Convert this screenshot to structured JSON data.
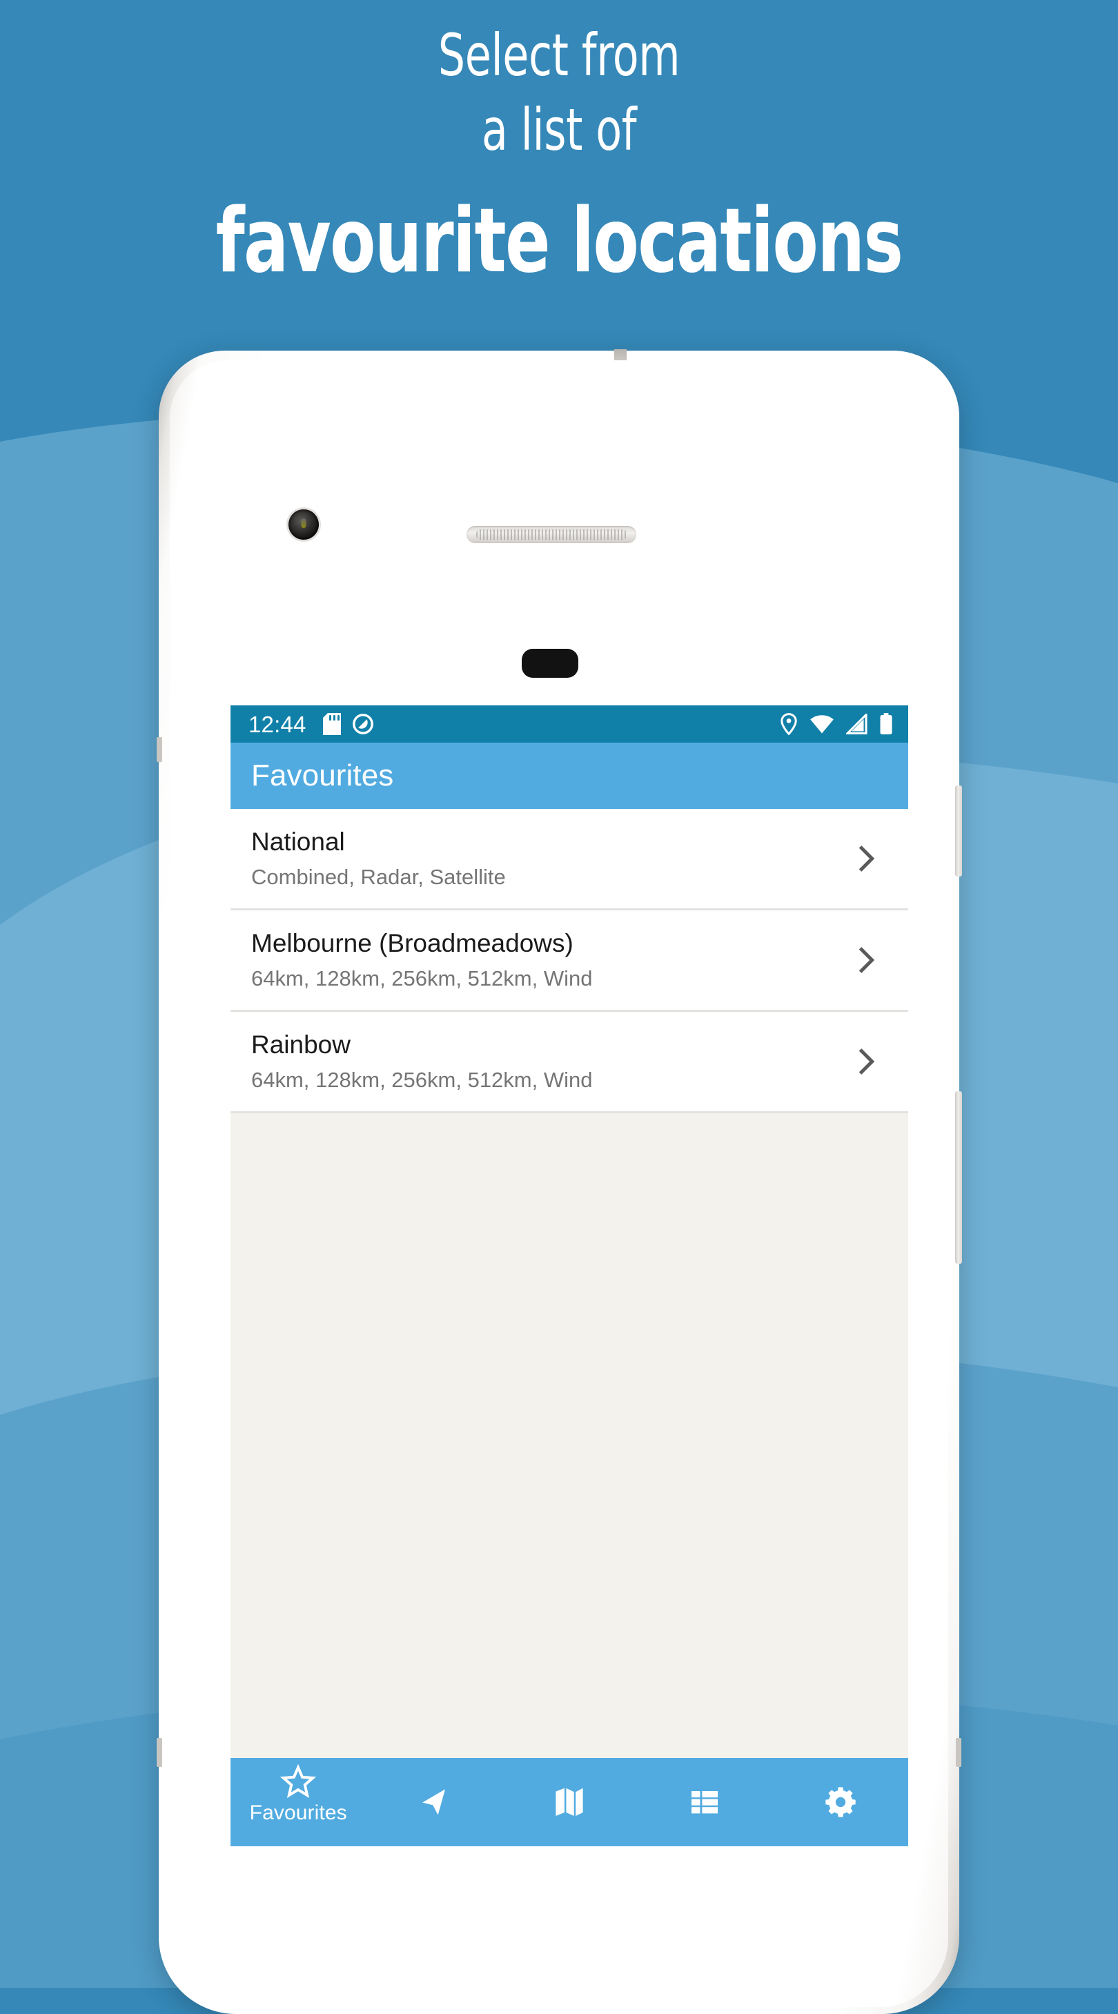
{
  "promo": {
    "line1": "Select from",
    "line2": "a list of",
    "line3": "favourite locations"
  },
  "colors": {
    "page_background": "#3588b8",
    "wave_mid": "#5ba2cb",
    "wave_light": "#79b7d9",
    "status_bar": "#1180a8",
    "app_bar": "#51abe0",
    "bottom_nav": "#51abe0",
    "list_row": "#ffffff",
    "list_empty": "#f4f2ec",
    "title_text": "#1b1b1b",
    "subtitle_text": "#757575",
    "chevron": "#5a5a5a"
  },
  "phone": {
    "status_bar": {
      "time": "12:44",
      "left_icons": [
        "sd-card-icon",
        "do-not-disturb-icon"
      ],
      "right_icons": [
        "location-pin-icon",
        "wifi-icon",
        "cell-signal-icon",
        "battery-icon"
      ]
    },
    "app_bar": {
      "title": "Favourites"
    },
    "favourites": [
      {
        "title": "National",
        "subtitle": "Combined, Radar, Satellite",
        "chevron": "chevron-right-icon"
      },
      {
        "title": "Melbourne (Broadmeadows)",
        "subtitle": "64km, 128km, 256km, 512km, Wind",
        "chevron": "chevron-right-icon"
      },
      {
        "title": "Rainbow",
        "subtitle": "64km, 128km, 256km, 512km, Wind",
        "chevron": "chevron-right-icon"
      }
    ],
    "bottom_nav": [
      {
        "icon": "star-outline-icon",
        "label": "Favourites",
        "active": true
      },
      {
        "icon": "navigation-arrow-icon",
        "label": "",
        "active": false
      },
      {
        "icon": "map-icon",
        "label": "",
        "active": false
      },
      {
        "icon": "list-icon",
        "label": "",
        "active": false
      },
      {
        "icon": "settings-gear-icon",
        "label": "",
        "active": false
      }
    ],
    "hardware": {
      "front_camera": "front-camera",
      "earpiece": "earpiece-speaker",
      "sensor": "proximity-sensor",
      "power_button": "power-button",
      "volume_button": "volume-rocker"
    }
  }
}
